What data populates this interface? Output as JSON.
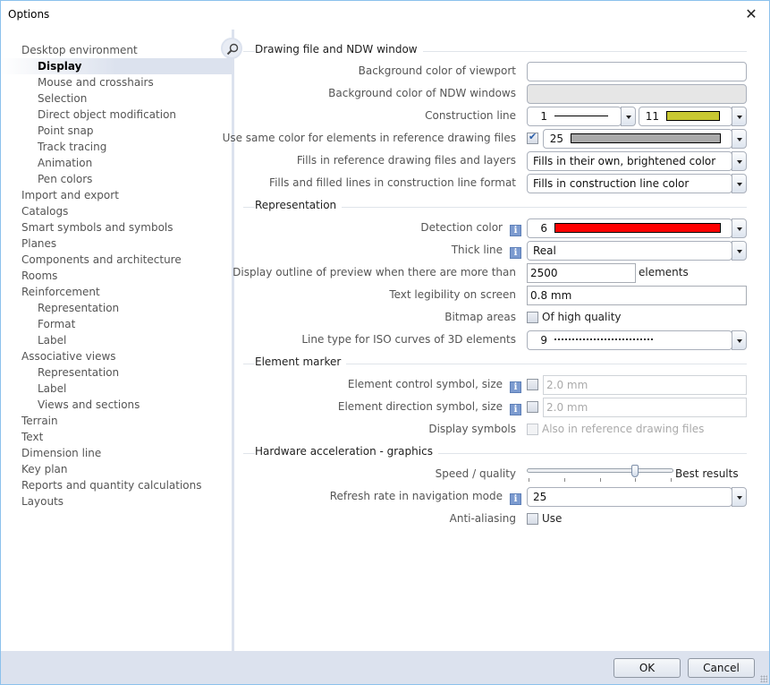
{
  "window": {
    "title": "Options",
    "close_icon": "close-icon"
  },
  "sidebar": {
    "search_icon": "search-icon",
    "info_icon": "info-icon",
    "items": [
      {
        "label": "Desktop environment",
        "level": 0
      },
      {
        "label": "Display",
        "level": 1,
        "selected": true
      },
      {
        "label": "Mouse and crosshairs",
        "level": 1
      },
      {
        "label": "Selection",
        "level": 1
      },
      {
        "label": "Direct object modification",
        "level": 1
      },
      {
        "label": "Point snap",
        "level": 1
      },
      {
        "label": "Track tracing",
        "level": 1
      },
      {
        "label": "Animation",
        "level": 1
      },
      {
        "label": "Pen colors",
        "level": 1
      },
      {
        "label": "Import and export",
        "level": 0
      },
      {
        "label": "Catalogs",
        "level": 0
      },
      {
        "label": "Smart symbols and symbols",
        "level": 0
      },
      {
        "label": "Planes",
        "level": 0
      },
      {
        "label": "Components and architecture",
        "level": 0
      },
      {
        "label": "Rooms",
        "level": 0
      },
      {
        "label": "Reinforcement",
        "level": 0
      },
      {
        "label": "Representation",
        "level": 1
      },
      {
        "label": "Format",
        "level": 1
      },
      {
        "label": "Label",
        "level": 1
      },
      {
        "label": "Associative views",
        "level": 0
      },
      {
        "label": "Representation",
        "level": 1
      },
      {
        "label": "Label",
        "level": 1
      },
      {
        "label": "Views and sections",
        "level": 1
      },
      {
        "label": "Terrain",
        "level": 0
      },
      {
        "label": "Text",
        "level": 0
      },
      {
        "label": "Dimension line",
        "level": 0
      },
      {
        "label": "Key plan",
        "level": 0
      },
      {
        "label": "Reports and quantity calculations",
        "level": 0
      },
      {
        "label": "Layouts",
        "level": 0
      }
    ]
  },
  "sections": {
    "drawing": {
      "title": "Drawing file and NDW window",
      "bg_viewport": {
        "label": "Background color of viewport",
        "value": "",
        "color": "#ffffff"
      },
      "bg_ndw": {
        "label": "Background color of NDW windows",
        "value": "",
        "color": "#e6e6e6"
      },
      "construction_line": {
        "label": "Construction line",
        "line_value": "1",
        "color_value": "11",
        "color": "#c8c832"
      },
      "same_color": {
        "label": "Use same color for elements in reference drawing files",
        "checked": true,
        "color_value": "25",
        "color": "#a9a9a9"
      },
      "fills_ref": {
        "label": "Fills in reference drawing files and layers",
        "value": "Fills in their own, brightened color"
      },
      "fills_construction": {
        "label": "Fills and filled lines in construction line format",
        "value": "Fills in construction line color"
      }
    },
    "representation": {
      "title": "Representation",
      "detection_color": {
        "label": "Detection color",
        "value": "6",
        "color": "#ff0000"
      },
      "thick_line": {
        "label": "Thick line",
        "value": "Real"
      },
      "outline_preview": {
        "label": "Display outline of preview when there are more than",
        "value": "2500",
        "suffix": "elements"
      },
      "text_legibility": {
        "label": "Text legibility on screen",
        "value": "0.8 mm"
      },
      "bitmap_areas": {
        "label": "Bitmap areas",
        "checkbox_label": "Of high quality",
        "checked": false
      },
      "iso_line_type": {
        "label": "Line type for ISO curves of 3D elements",
        "value": "9"
      }
    },
    "element_marker": {
      "title": "Element marker",
      "control_symbol": {
        "label": "Element control symbol, size",
        "checked": false,
        "value": "2.0 mm"
      },
      "direction_symbol": {
        "label": "Element direction symbol, size",
        "checked": false,
        "value": "2.0 mm"
      },
      "display_symbols": {
        "label": "Display symbols",
        "checkbox_label": "Also in reference drawing files",
        "checked": false
      }
    },
    "hardware": {
      "title": "Hardware acceleration - graphics",
      "speed_quality": {
        "label": "Speed / quality",
        "value": 3,
        "max": 4,
        "end_label": "Best results"
      },
      "refresh_rate": {
        "label": "Refresh rate in navigation mode",
        "value": "25"
      },
      "anti_aliasing": {
        "label": "Anti-aliasing",
        "checkbox_label": "Use",
        "checked": false
      }
    }
  },
  "footer": {
    "ok_label": "OK",
    "cancel_label": "Cancel"
  }
}
